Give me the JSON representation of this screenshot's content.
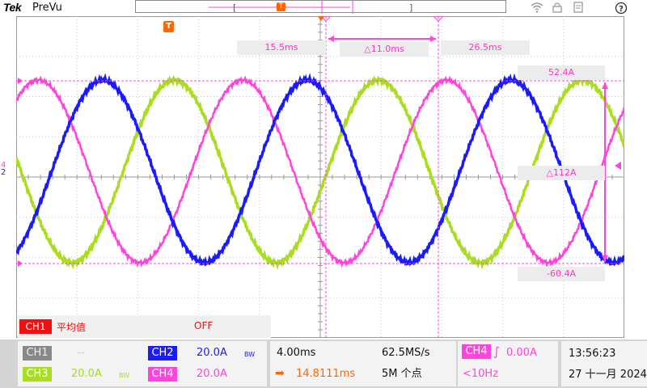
{
  "header": {
    "brand": "Tek",
    "mode": "PreVu",
    "trigger_marker": "T"
  },
  "toolbar_icons": [
    "wifi-icon",
    "lock-icon",
    "menu-icon",
    "help-icon"
  ],
  "cursors": {
    "time_a": "15.5ms",
    "delta_time": "△11.0ms",
    "time_b": "26.5ms",
    "level_a": "52.4A",
    "delta_level": "△112A",
    "level_b": "-60.4A"
  },
  "markers": {
    "ch4_level": "4",
    "ch2_level": "2"
  },
  "math_panel": {
    "channel": "CH1",
    "function": "平均值",
    "state": "OFF"
  },
  "channels": [
    {
      "name": "CH1",
      "scale": "--",
      "bw": "",
      "color": "#888888",
      "text_color": "#cccccc"
    },
    {
      "name": "CH2",
      "scale": "20.0A",
      "bw": "BW",
      "color": "#1a1aff",
      "text_color": "#1a1aff"
    },
    {
      "name": "CH3",
      "scale": "20.0A",
      "bw": "BW",
      "color": "#aadd22",
      "text_color": "#aadd22"
    },
    {
      "name": "CH4",
      "scale": "20.0A",
      "bw": "",
      "color": "#ff44dd",
      "text_color": "#ff44dd"
    }
  ],
  "timebase": {
    "scale": "4.00ms",
    "sample_rate": "62.5MS/s",
    "position": "14.8111ms",
    "record_length": "5M 个点"
  },
  "trigger": {
    "source": "CH4",
    "slope": "∫",
    "level": "0.00A",
    "frequency": "<10Hz"
  },
  "clock": {
    "time": "13:56:23",
    "date": "27 十一月 2024"
  },
  "colors": {
    "ch2": "#1a1aff",
    "ch3": "#aadd22",
    "ch4": "#ff44dd",
    "cursor": "#ff44dd",
    "trigger": "#ff6600",
    "ch1_tag": "#ee1111"
  }
}
